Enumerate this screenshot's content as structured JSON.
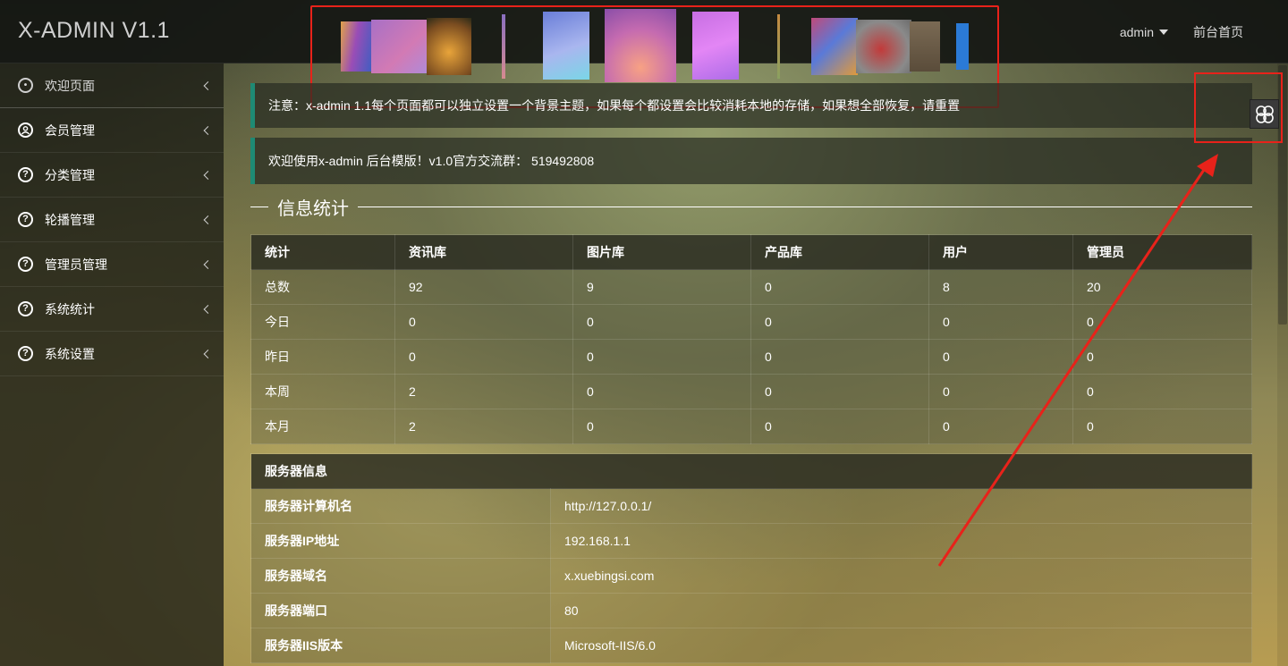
{
  "header": {
    "logo": "X-ADMIN V1.1",
    "user": "admin",
    "front_link": "前台首页"
  },
  "sidebar": {
    "items": [
      {
        "label": "欢迎页面",
        "icon": "palette-icon"
      },
      {
        "label": "会员管理",
        "icon": "user-circle-icon"
      },
      {
        "label": "分类管理",
        "icon": "question-circle-icon"
      },
      {
        "label": "轮播管理",
        "icon": "question-circle-icon"
      },
      {
        "label": "管理员管理",
        "icon": "question-circle-icon"
      },
      {
        "label": "系统统计",
        "icon": "question-circle-icon"
      },
      {
        "label": "系统设置",
        "icon": "question-circle-icon"
      }
    ]
  },
  "main": {
    "notice": "注意：x-admin 1.1每个页面都可以独立设置一个背景主题，如果每个都设置会比较消耗本地的存储，如果想全部恢复，请重置",
    "welcome": "欢迎使用x-admin 后台模版！v1.0官方交流群： 519492808",
    "section_title": "信息统计",
    "stats": {
      "headers": [
        "统计",
        "资讯库",
        "图片库",
        "产品库",
        "用户",
        "管理员"
      ],
      "rows": [
        [
          "总数",
          "92",
          "9",
          "0",
          "8",
          "20"
        ],
        [
          "今日",
          "0",
          "0",
          "0",
          "0",
          "0"
        ],
        [
          "昨日",
          "0",
          "0",
          "0",
          "0",
          "0"
        ],
        [
          "本周",
          "2",
          "0",
          "0",
          "0",
          "0"
        ],
        [
          "本月",
          "2",
          "0",
          "0",
          "0",
          "0"
        ]
      ]
    },
    "server": {
      "title": "服务器信息",
      "rows": [
        [
          "服务器计算机名",
          "http://127.0.0.1/"
        ],
        [
          "服务器IP地址",
          "192.168.1.1"
        ],
        [
          "服务器域名",
          "x.xuebingsi.com"
        ],
        [
          "服务器端口",
          "80"
        ],
        [
          "服务器IIS版本",
          "Microsoft-IIS/6.0"
        ]
      ]
    }
  },
  "theme_button": {
    "icon": "clover-icon"
  },
  "colors": {
    "highlight": "#e8221a",
    "accent": "#1e8a74"
  }
}
